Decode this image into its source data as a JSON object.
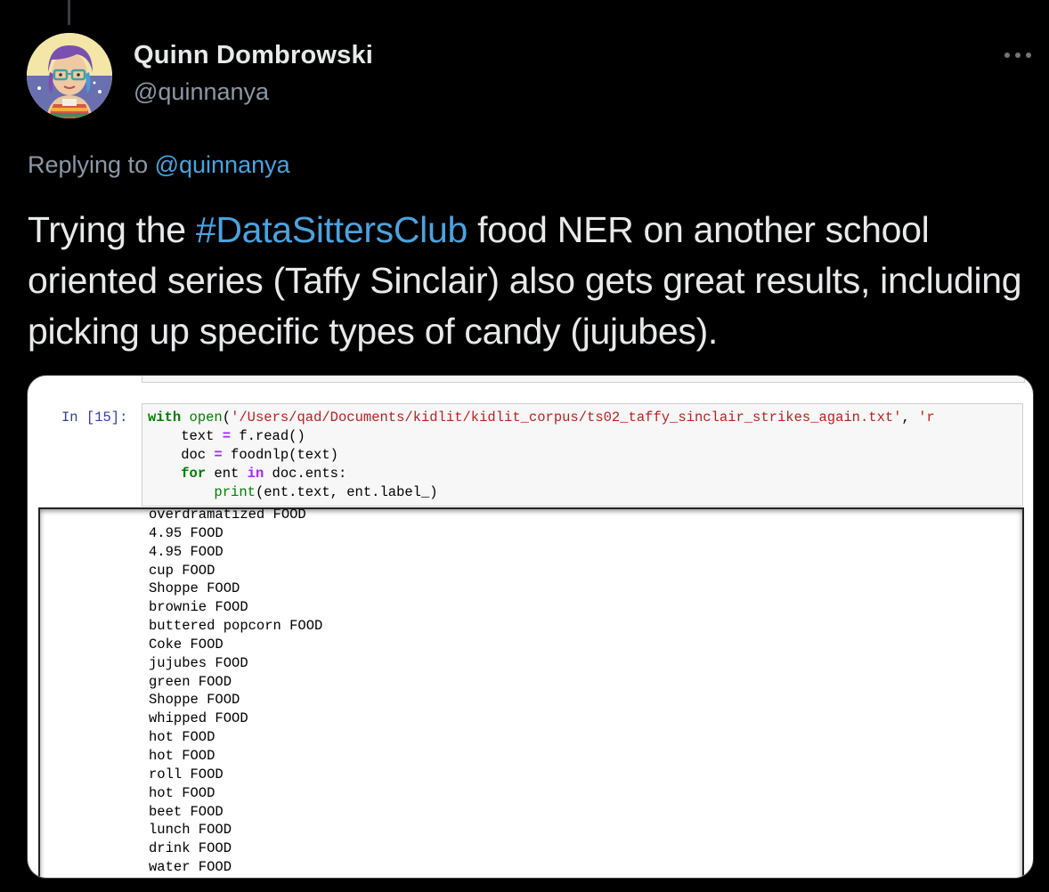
{
  "tweet": {
    "display_name": "Quinn Dombrowski",
    "handle": "@quinnanya",
    "replying_prefix": "Replying to ",
    "replying_handle": "@quinnanya",
    "text_before": "Trying the ",
    "hashtag": "#DataSittersClub",
    "text_after": " food NER on another school oriented series (Taffy Sinclair) also gets great results, including picking up specific types of candy (jujubes).",
    "more_icon": "more-horizontal-icon"
  },
  "notebook": {
    "prompt": "In [15]:",
    "code": {
      "line1_kw": "with",
      "line1_fn": "open",
      "line1_open_paren": "(",
      "line1_str": "'/Users/qad/Documents/kidlit/kidlit_corpus/ts02_taffy_sinclair_strikes_again.txt'",
      "line1_sep": ", ",
      "line1_str2": "'r",
      "line2_a": "    text ",
      "line2_eq": "=",
      "line2_b": " f.read()",
      "line3_a": "    doc ",
      "line3_eq": "=",
      "line3_b": " foodnlp(text)",
      "line4_kw": "for",
      "line4_a": " ent ",
      "line4_in": "in",
      "line4_b": " doc.ents:",
      "line5_fn": "print",
      "line5_b": "(ent.text, ent.label_)"
    },
    "output": [
      "overdramatized FOOD",
      "4.95 FOOD",
      "4.95 FOOD",
      "cup FOOD",
      "Shoppe FOOD",
      "brownie FOOD",
      "buttered popcorn FOOD",
      "Coke FOOD",
      "jujubes FOOD",
      "green FOOD",
      "Shoppe FOOD",
      "whipped FOOD",
      "hot FOOD",
      "hot FOOD",
      "roll FOOD",
      "hot FOOD",
      "beet FOOD",
      "lunch FOOD",
      "drink FOOD",
      "water FOOD"
    ]
  },
  "colors": {
    "background": "#000000",
    "text": "#e7e9ea",
    "secondary": "#8b98a5",
    "link": "#4aa3df"
  }
}
